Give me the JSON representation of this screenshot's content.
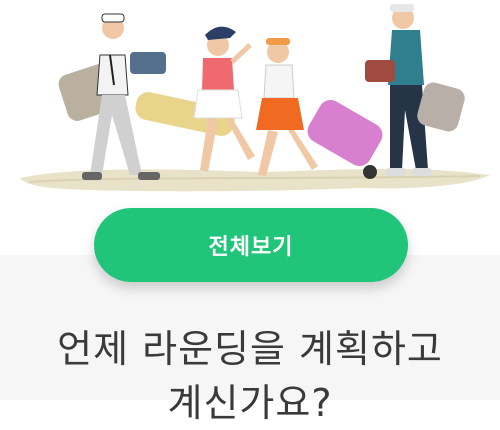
{
  "banner": {
    "illustration": "golfers-walking-illustration"
  },
  "cta": {
    "label": "전체보기",
    "color": "#21c579"
  },
  "prompt": {
    "line1": "언제 라운딩을 계획하고",
    "line2": "계신가요?"
  }
}
